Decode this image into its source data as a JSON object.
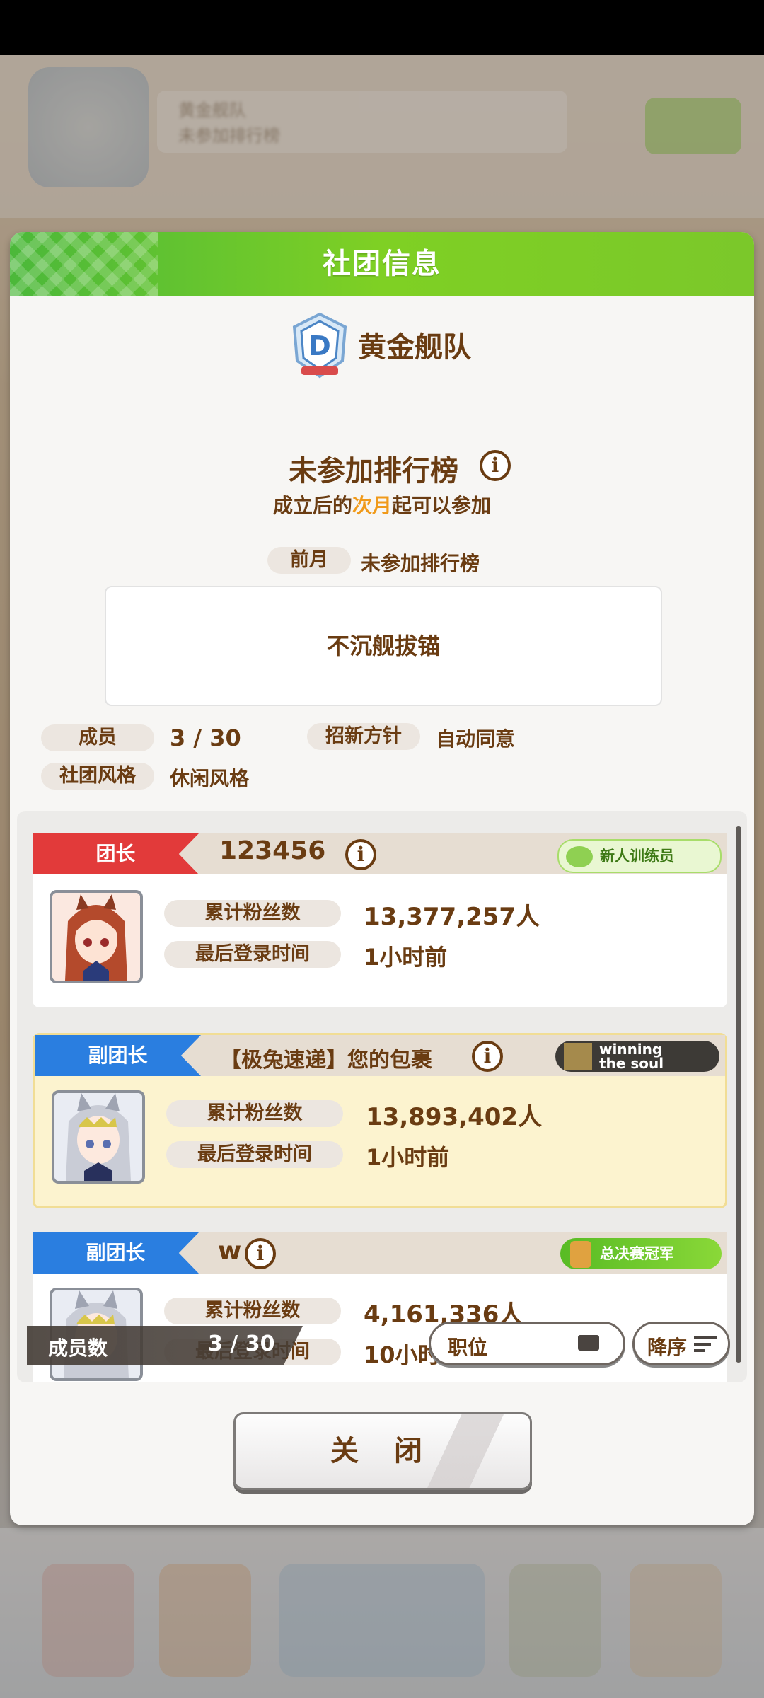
{
  "background": {
    "club_name_blur": "黄金舰队",
    "club_sub_blur": "未参加排行榜"
  },
  "panel": {
    "title": "社团信息",
    "club_name": "黄金舰队",
    "ranking": {
      "status": "未参加排行榜",
      "note_prefix": "成立后的",
      "note_highlight": "次月",
      "note_suffix": "起可以参加",
      "last_month_label": "前月",
      "last_month_value": "未参加排行榜"
    },
    "motto": "不沉舰拔锚",
    "members_label": "成员",
    "members_value": "3 / 30",
    "recruit_label": "招新方针",
    "recruit_value": "自动同意",
    "style_label": "社团风格",
    "style_value": "休闲风格"
  },
  "members": [
    {
      "role": "团长",
      "name": "123456",
      "title_badge": "新人训练员",
      "fans_label": "累计粉丝数",
      "fans_value": "13,377,257人",
      "login_label": "最后登录时间",
      "login_value": "1小时前"
    },
    {
      "role": "副团长",
      "name": "【极兔速递】您的包裹",
      "title_badge": "winning the soul",
      "title_badge_line1": "winning",
      "title_badge_line2": "the soul",
      "fans_label": "累计粉丝数",
      "fans_value": "13,893,402人",
      "login_label": "最后登录时间",
      "login_value": "1小时前"
    },
    {
      "role": "副团长",
      "name": "w",
      "title_badge": "总决赛冠军",
      "fans_label": "累计粉丝数",
      "fans_value": "4,161,336人",
      "login_label": "最后登录时间",
      "login_value": "10小时前"
    }
  ],
  "footer": {
    "count_label": "成员数",
    "count_value": "3 / 30",
    "sort_field": "职位",
    "sort_order": "降序"
  },
  "close_label": "关 闭",
  "colors": {
    "accent_green": "#7fd024",
    "text_brown": "#6a3c12",
    "leader_red": "#e23a3a",
    "vice_blue": "#2a7ee0",
    "highlight_orange": "#f09a1a"
  },
  "icons": [
    "club-badge-icon",
    "info-icon",
    "avatar-icon",
    "card-stack-icon",
    "sort-lines-icon"
  ]
}
